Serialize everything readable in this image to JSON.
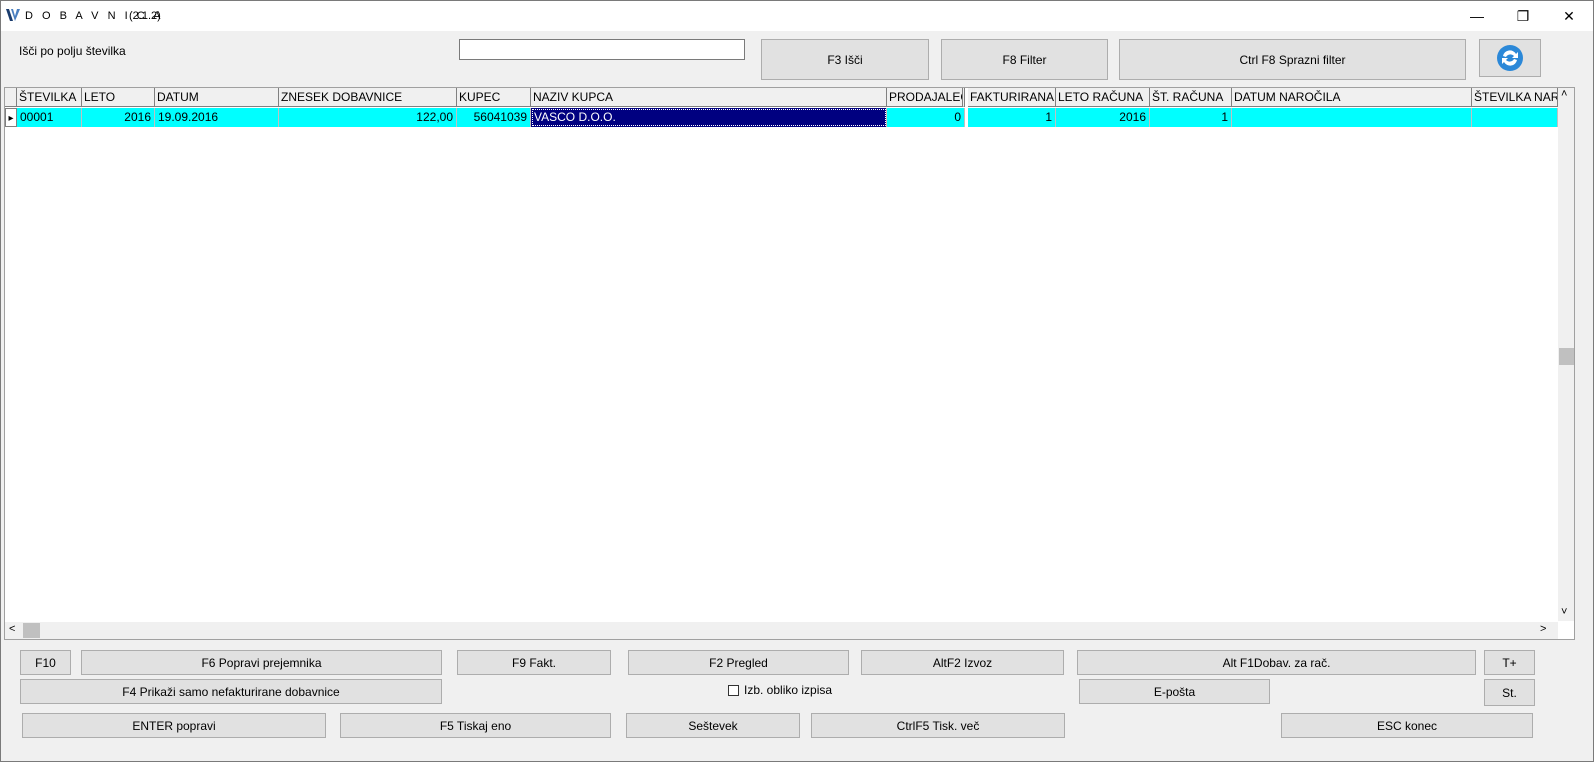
{
  "window": {
    "title": "D O B A V N I C A",
    "version": "(2.1.2)",
    "minimize_glyph": "—",
    "restore_glyph": "❐",
    "close_glyph": "✕"
  },
  "search": {
    "label": "Išči po polju  številka",
    "value": "",
    "find_button": "F3 Išči",
    "filter_button": "F8 Filter",
    "clear_filter_button": "Ctrl F8 Sprazni filter",
    "refresh_icon": "refresh-icon"
  },
  "grid": {
    "columns": [
      "ŠTEVILKA",
      "LETO",
      "DATUM",
      "ZNESEK DOBAVNICE",
      "KUPEC",
      "NAZIV KUPCA",
      "PRODAJALEC",
      "FAKTURIRANA",
      "LETO RAČUNA",
      "ŠT. RAČUNA",
      "DATUM NAROČILA",
      "ŠTEVILKA NAROČILA"
    ],
    "rows": [
      {
        "indicator": "▸",
        "cells": [
          "00001",
          "2016",
          "19.09.2016",
          "122,00",
          "56041039",
          "VASCO D.O.O.",
          "0",
          "1",
          "2016",
          "1",
          "",
          ""
        ]
      }
    ],
    "row_color": "#00ffff",
    "selected_color": "#000080"
  },
  "scroll": {
    "up": "˄",
    "down": "˅",
    "left": "<",
    "right": ">"
  },
  "buttons": {
    "f10": "F10",
    "f6": "F6 Popravi prejemnika",
    "f9": "F9 Fakt.",
    "f2": "F2 Pregled",
    "altf2": "AltF2 Izvoz",
    "altf1": "Alt F1Dobav. za rač.",
    "tplus": "T+",
    "f4": "F4 Prikaži samo nefakturirane dobavnice",
    "eposta": "E-pošta",
    "st": "St.",
    "enter": "ENTER popravi",
    "f5": "F5 Tiskaj eno",
    "sestevek": "Seštevek",
    "ctrlf5": "CtrlF5 Tisk. več",
    "esc": "ESC  konec"
  },
  "checkbox": {
    "label": "Izb. obliko izpisa",
    "checked": false
  }
}
